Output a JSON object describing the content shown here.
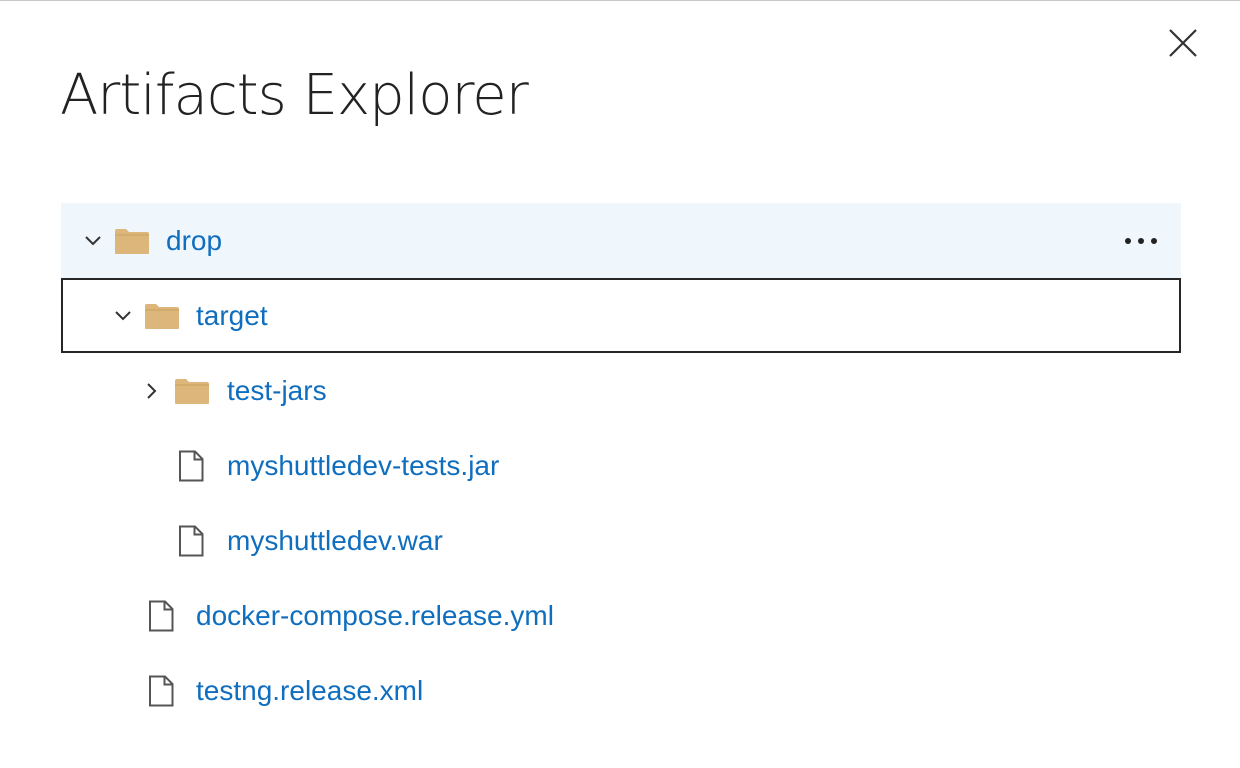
{
  "dialog": {
    "title": "Artifacts Explorer",
    "close_icon": "close-icon"
  },
  "tree": {
    "items": [
      {
        "label": "drop",
        "type": "folder",
        "expanded": true,
        "depth": 0,
        "selected": true,
        "more_icon": "ellipsis-icon"
      },
      {
        "label": "target",
        "type": "folder",
        "expanded": true,
        "depth": 1,
        "focused": true
      },
      {
        "label": "test-jars",
        "type": "folder",
        "expanded": false,
        "depth": 2
      },
      {
        "label": "myshuttledev-tests.jar",
        "type": "file",
        "depth": 2
      },
      {
        "label": "myshuttledev.war",
        "type": "file",
        "depth": 2
      },
      {
        "label": "docker-compose.release.yml",
        "type": "file",
        "depth": 1
      },
      {
        "label": "testng.release.xml",
        "type": "file",
        "depth": 1
      }
    ]
  },
  "colors": {
    "link": "#106ebe",
    "folder": "#dcb67a",
    "selected_bg": "#eff6fc",
    "focus_border": "#262626"
  }
}
